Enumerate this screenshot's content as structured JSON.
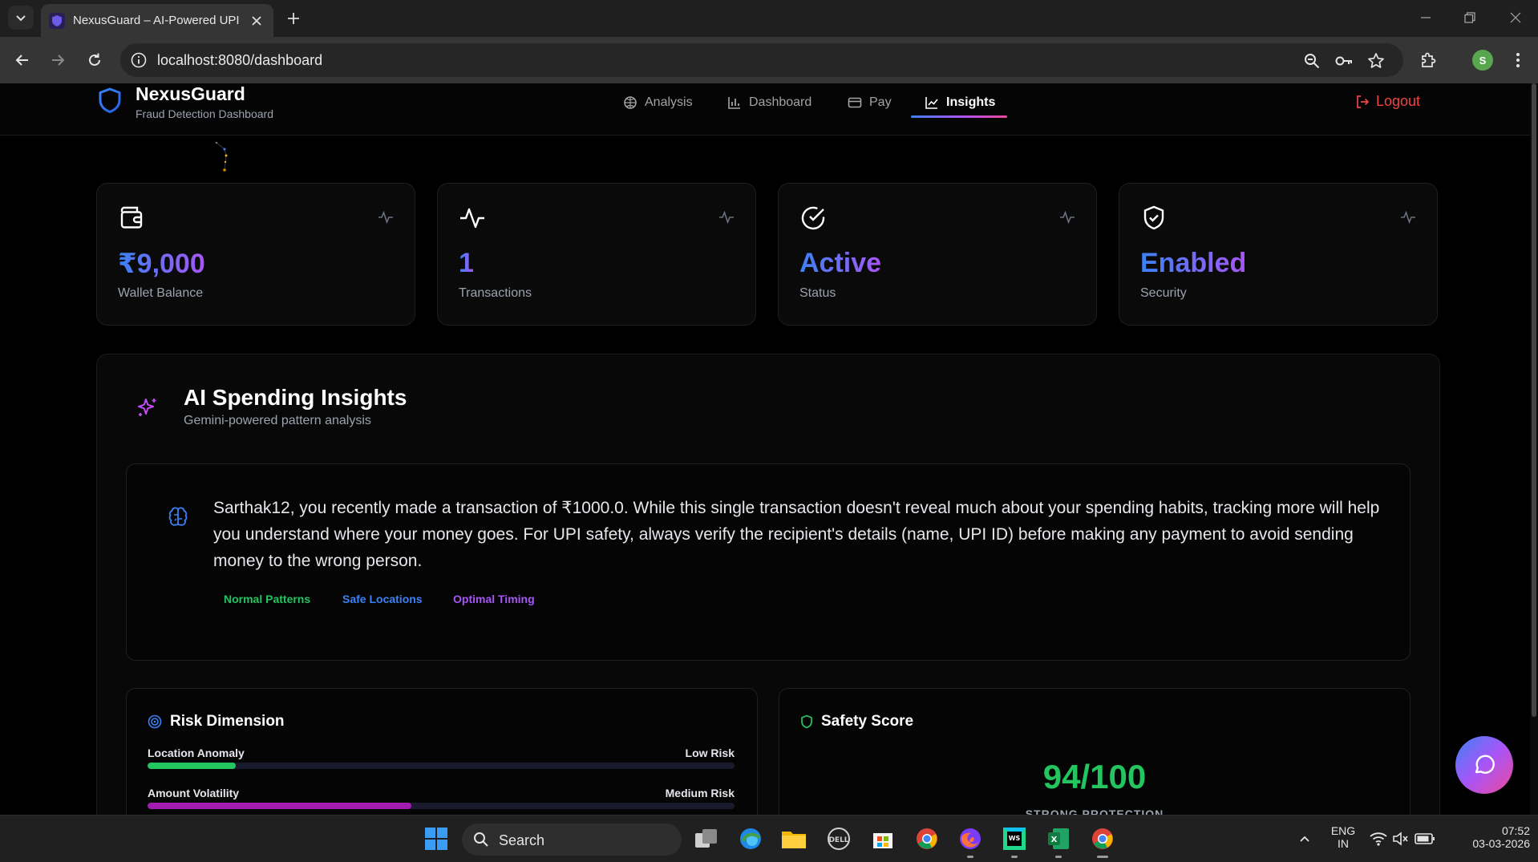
{
  "browser": {
    "tab_title": "NexusGuard – AI-Powered UPI F",
    "url": "localhost:8080/dashboard",
    "profile_initial": "S"
  },
  "app": {
    "brand_name": "NexusGuard",
    "brand_subtitle": "Fraud Detection Dashboard",
    "nav": [
      {
        "label": "Analysis",
        "icon": "analysis-icon"
      },
      {
        "label": "Dashboard",
        "icon": "bar-chart-icon"
      },
      {
        "label": "Pay",
        "icon": "card-icon"
      },
      {
        "label": "Insights",
        "icon": "line-chart-icon",
        "active": true
      }
    ],
    "logout_label": "Logout"
  },
  "stats": [
    {
      "value": "₹9,000",
      "label": "Wallet Balance",
      "icon": "wallet-icon"
    },
    {
      "value": "1",
      "label": "Transactions",
      "icon": "pulse-icon"
    },
    {
      "value": "Active",
      "label": "Status",
      "icon": "check-circle-icon"
    },
    {
      "value": "Enabled",
      "label": "Security",
      "icon": "shield-check-icon"
    }
  ],
  "insights": {
    "title": "AI Spending Insights",
    "subtitle": "Gemini-powered pattern analysis",
    "message": "Sarthak12, you recently made a transaction of ₹1000.0. While this single transaction doesn't reveal much about your spending habits, tracking more will help you understand where your money goes. For UPI safety, always verify the recipient's details (name, UPI ID) before making any payment to avoid sending money to the wrong person.",
    "tags": [
      {
        "label": "Normal Patterns",
        "color": "#22c55e"
      },
      {
        "label": "Safe Locations",
        "color": "#3b82f6"
      },
      {
        "label": "Optimal Timing",
        "color": "#a855f7"
      }
    ]
  },
  "risk": {
    "title": "Risk Dimension",
    "rows": [
      {
        "label": "Location Anomaly",
        "level": "Low Risk",
        "fill_fraction": 0.15,
        "color": "#22c55e"
      },
      {
        "label": "Amount Volatility",
        "level": "Medium Risk",
        "fill_fraction": 0.45,
        "color": "#a21caf"
      }
    ]
  },
  "safety": {
    "title": "Safety Score",
    "score": "94/100",
    "label": "STRONG PROTECTION"
  },
  "taskbar": {
    "search_label": "Search",
    "lang_line1": "ENG",
    "lang_line2": "IN",
    "time": "07:52",
    "date": "03-03-2026"
  }
}
